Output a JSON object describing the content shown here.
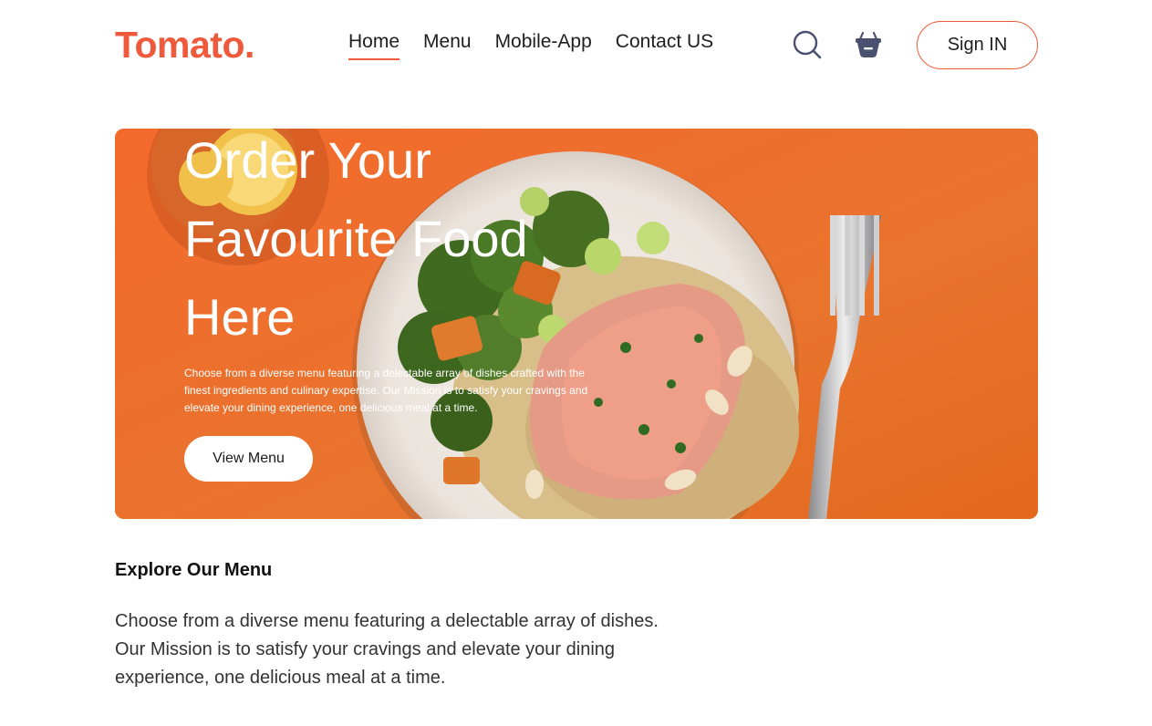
{
  "brand": {
    "logo_text": "Tomato.",
    "accent_color": "#ef5a3c"
  },
  "nav": {
    "links": [
      {
        "label": "Home",
        "active": true
      },
      {
        "label": "Menu",
        "active": false
      },
      {
        "label": "Mobile-App",
        "active": false
      },
      {
        "label": "Contact US",
        "active": false
      }
    ],
    "search_icon": "search-icon",
    "basket_icon": "basket-icon",
    "signin_label": "Sign IN"
  },
  "hero": {
    "title_line1": "Order Your",
    "title_line2": "Favourite Food",
    "title_line3": "Here",
    "description": "Choose from a diverse menu featuring a delectable array of dishes crafted with the finest ingredients and culinary expertise. Our Mission is to satisfy your cravings and elevate your dining experience, one delicious meal at a time.",
    "button_label": "View Menu",
    "background_color": "#e8742e"
  },
  "explore": {
    "heading": "Explore Our Menu",
    "description": "Choose from a diverse menu featuring a delectable array of dishes. Our Mission is to satisfy your cravings and elevate your dining experience, one delicious meal at a time."
  }
}
